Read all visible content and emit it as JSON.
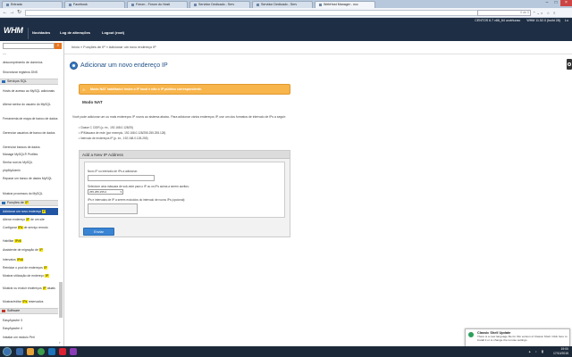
{
  "browser": {
    "tabs": [
      {
        "label": "Entrada",
        "active": false
      },
      {
        "label": "Facebook",
        "active": false
      },
      {
        "label": "Fórum - Fórum do Hosti",
        "active": false
      },
      {
        "label": "Servidor Dedicado - Serv",
        "active": false
      },
      {
        "label": "Servidor Dedicado - Serv",
        "active": false
      },
      {
        "label": "WebHost Manager - ncc",
        "active": true
      }
    ],
    "url": "",
    "find_value": "",
    "find_count": "0 de 0"
  },
  "whm": {
    "logo": "WHM",
    "sysinfo": "CENTOS 6.7 x86_64 ucvirtuoso",
    "sysinfo_extra": "WHM 11.52.0 (build 28)",
    "sysinfo_load": "Lo",
    "nav": [
      {
        "label": "Novidades"
      },
      {
        "label": "Log de alterações"
      },
      {
        "label": "Logout (root)"
      }
    ]
  },
  "sidebar": {
    "search_icon": "search-icon",
    "expand_label": "—",
    "items_top": [
      {
        "label": "descomprimento de domínios"
      },
      {
        "label": "Sincronizar registros DNS"
      }
    ],
    "section_sql": "Serviços SQL",
    "sql_items": [
      {
        "label": "Hosts de acesso ao MySQL adicionais"
      },
      {
        "label": "Alterar senha do usuário do MySQL"
      },
      {
        "label": "Ferramenta de mapa de banco de dados"
      },
      {
        "label": "Gerenciar usuários de banco de dados"
      },
      {
        "label": "Gerenciar bancos de dados"
      },
      {
        "label": "Manage MySQL® Profiles"
      },
      {
        "label": "Senha root do MySQL"
      },
      {
        "label": "phpMyAdmin"
      },
      {
        "label": "Reparar um banco de dados MySQL"
      },
      {
        "label": "Mostrar processos do MySQL"
      }
    ],
    "section_ip": "Funções de",
    "section_ip_hl": "IP",
    "ip_items": [
      {
        "pre": "Adicionar um novo endereço ",
        "hl": "IP",
        "post": "",
        "selected": true
      },
      {
        "pre": "Alterar endereço ",
        "hl": "IP",
        "post": " de um site",
        "selected": false
      },
      {
        "pre": "Configurar ",
        "hl": "IPs",
        "post": " de serviço remoto",
        "selected": false
      },
      {
        "pre": "Habilitar ",
        "hl": "IPv6",
        "post": "",
        "selected": false
      },
      {
        "pre": "Assistente de migração de ",
        "hl": "IP",
        "post": "",
        "selected": false
      },
      {
        "pre": "Intervalos ",
        "hl": "IPv6",
        "post": "",
        "selected": false
      },
      {
        "pre": "Reiniciar o pool de endereços ",
        "hl": "IP",
        "post": "",
        "selected": false
      },
      {
        "pre": "Mostrar utilização de endereço ",
        "hl": "IP",
        "post": "",
        "selected": false
      },
      {
        "pre": "Mostrar ou excluir endereços ",
        "hl": "IP",
        "post": " atuais",
        "selected": false
      },
      {
        "pre": "Mostrar/editar ",
        "hl": "IPs",
        "post": " reservados",
        "selected": false
      }
    ],
    "section_software": "Software",
    "software_items": [
      {
        "label": "EasyApache 3"
      },
      {
        "label": "EasyApache 4"
      },
      {
        "label": "Instalar um módulo Perl"
      }
    ]
  },
  "main": {
    "breadcrumb": "Início » Funções de IP » Adicionar um novo endereço IP",
    "title": "Adicionar um novo endereço IP",
    "notice": "Modo NAT habilitado! Insira o IP local e não o IP público correspondente.",
    "nat_heading": "Modo NAT",
    "nat_desc": "Você pode adicionar um ou mais endereços IP novos ao sistema abaixo. Para adicionar vários endereços IP, use um dos formatos de intervalo de IPs a seguir:",
    "formats": [
      "Classe C CIDR (p. ex., 192.168.0.128/25)",
      "IP/Máscara de rede (por exemplo, 192.168.0.128/255.255.255.128)",
      "Intervalo de endereços IP (p. ex., 192.168.0.128-255)"
    ],
    "form": {
      "header": "Add a New IP Address",
      "ip_label": "Novo IP ou intervalo de IPs a adicionar:",
      "ip_value": "",
      "mask_label": "Selecione uma máscara de sub-rede para o IP ou os IPs acima a serem aceitos:",
      "mask_value": "255.255.255.0",
      "range_label": "IPs e intervalos de IP a serem excluídos do intervalo de novos IPs (opcional):",
      "range_value": "",
      "submit_label": "Enviar"
    }
  },
  "toast": {
    "title": "Classic Shell Update",
    "body": "There is a new language file for this version of Classic Shell. Click here to install it or to change the remote settings."
  },
  "taskbar": {
    "time": "19:00",
    "date": "17/10/2015"
  },
  "colors": {
    "header_bg": "#1e2e44",
    "accent_orange": "#e8741c",
    "selected_blue": "#2255a4",
    "notice_orange": "#f8b54c",
    "title_blue": "#1d4f86",
    "highlight_yellow": "#f4e50a",
    "submit_blue": "#3a84d4"
  }
}
